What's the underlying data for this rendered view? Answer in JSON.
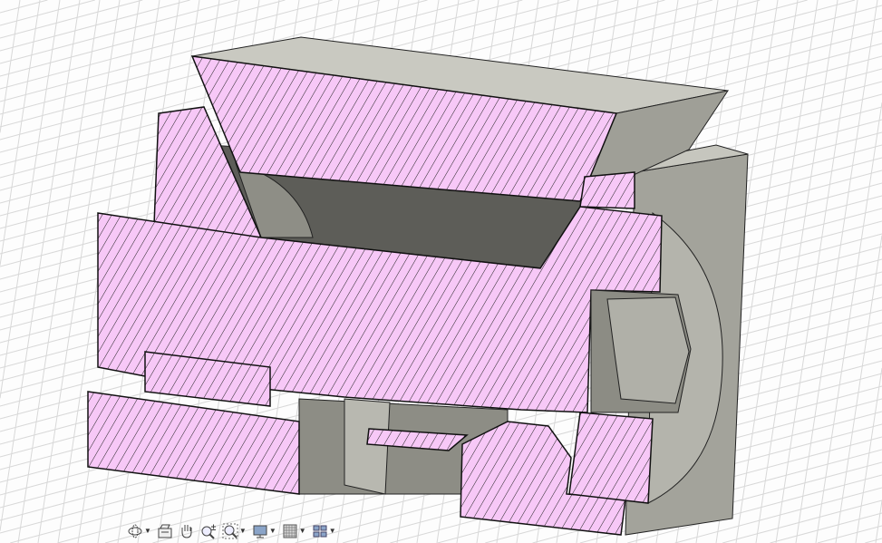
{
  "viewport": {
    "type": "section-analysis",
    "hatch_color": "#f7c8f7",
    "body_color": "#a8a8a0"
  },
  "toolbar": {
    "items": [
      {
        "icon": "orbit-icon",
        "dropdown": true
      },
      {
        "icon": "look-at-icon",
        "dropdown": false
      },
      {
        "icon": "pan-hand-icon",
        "dropdown": false
      },
      {
        "icon": "zoom-icon",
        "dropdown": false
      },
      {
        "icon": "fit-window-icon",
        "dropdown": true
      },
      {
        "icon": "display-settings-icon",
        "dropdown": true
      },
      {
        "icon": "grid-icon",
        "dropdown": true
      },
      {
        "icon": "viewports-icon",
        "dropdown": true
      }
    ]
  }
}
